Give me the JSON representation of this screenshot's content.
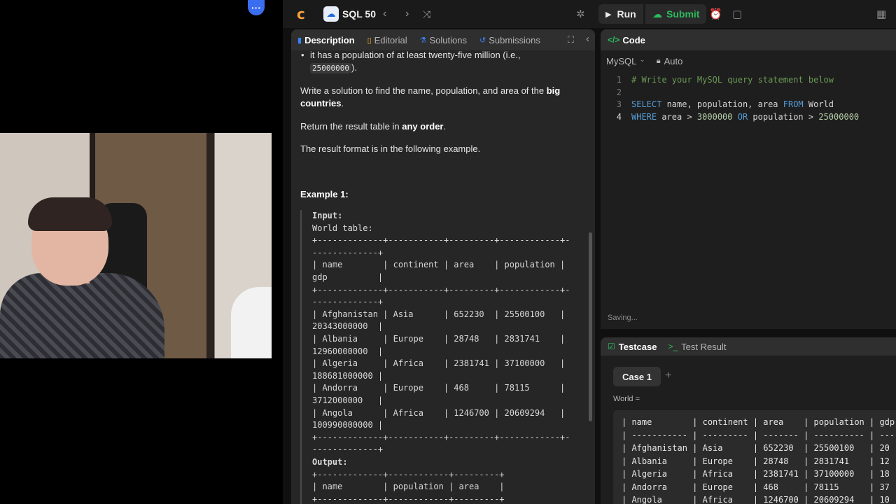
{
  "topbar": {
    "list_title": "SQL 50",
    "run_label": "Run",
    "submit_label": "Submit"
  },
  "desc_tabs": {
    "description": "Description",
    "editorial": "Editorial",
    "solutions": "Solutions",
    "submissions": "Submissions"
  },
  "description": {
    "bullet_text": "it has a population of at least twenty-five million (i.e.,",
    "bullet_code": "25000000",
    "bullet_end": ").",
    "p1_start": "Write a solution to find the name, population, and area of the ",
    "p1_bold": "big countries",
    "p1_end": ".",
    "p2_start": "Return the result table in ",
    "p2_bold": "any order",
    "p2_end": ".",
    "p3": "The result format is in the following example.",
    "example_title": "Example 1:",
    "input_label": "Input:",
    "input_text": "World table:\n+-------------+-----------+---------+------------+-\n-------------+\n| name        | continent | area    | population |\ngdp          |\n+-------------+-----------+---------+------------+-\n-------------+\n| Afghanistan | Asia      | 652230  | 25500100   |\n20343000000  |\n| Albania     | Europe    | 28748   | 2831741    |\n12960000000  |\n| Algeria     | Africa    | 2381741 | 37100000   |\n188681000000 |\n| Andorra     | Europe    | 468     | 78115      |\n3712000000   |\n| Angola      | Africa    | 1246700 | 20609294   |\n100990000000 |\n+-------------+-----------+---------+------------+-\n-------------+",
    "output_label": "Output:",
    "output_text": "+-------------+------------+---------+\n| name        | population | area    |\n+-------------+------------+---------+"
  },
  "code": {
    "title": "Code",
    "language": "MySQL",
    "mode": "Auto",
    "line_numbers": [
      "1",
      "2",
      "3",
      "4"
    ],
    "line1": "# Write your MySQL query statement below",
    "l3_select": "SELECT",
    "l3_cols": " name, population, area ",
    "l3_from": "FROM",
    "l3_table": " World",
    "l4_where": "WHERE",
    "l4_a": " area > ",
    "l4_n1": "3000000",
    "l4_or": " OR",
    "l4_b": " population > ",
    "l4_n2": "25000000",
    "saving": "Saving..."
  },
  "testcase": {
    "tab_testcase": "Testcase",
    "tab_result": "Test Result",
    "case_label": "Case 1",
    "add_label": "+",
    "world_label": "World =",
    "world_text": "| name        | continent | area    | population | gdp\n| ----------- | --------- | ------- | ---------- | ---\n| Afghanistan | Asia      | 652230  | 25500100   | 20\n| Albania     | Europe    | 28748   | 2831741    | 12\n| Algeria     | Africa    | 2381741 | 37100000   | 18\n| Andorra     | Europe    | 468     | 78115      | 37\n| Angola      | Africa    | 1246700 | 20609294   | 10"
  },
  "colors": {
    "accent_green": "#2cbb5d",
    "logo_orange": "#f7a23b",
    "badge_blue": "#3b6df0"
  }
}
